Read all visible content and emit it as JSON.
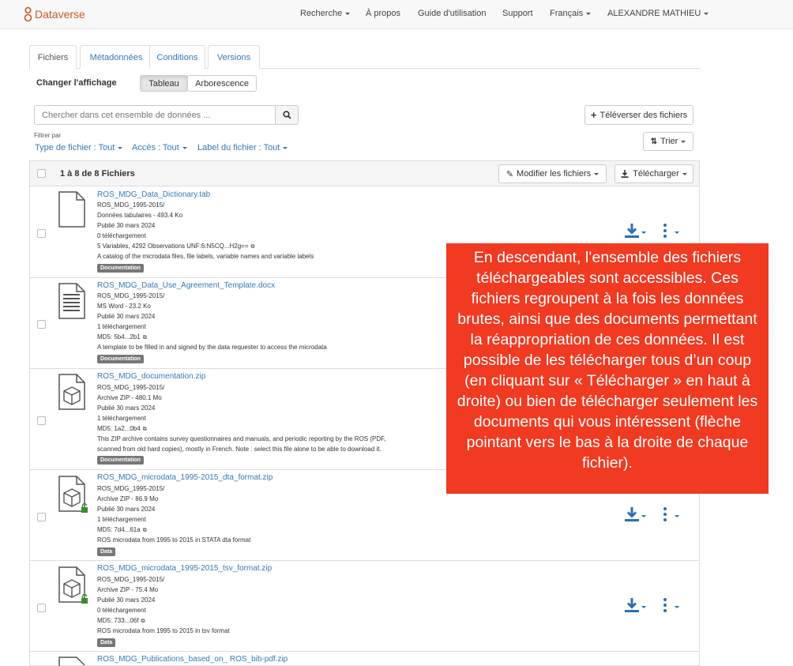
{
  "navbar": {
    "brand": "Dataverse",
    "items": [
      "Recherche",
      "À propos",
      "Guide d'utilisation",
      "Support",
      "Français",
      "ALEXANDRE MATHIEU"
    ]
  },
  "tabs": [
    "Fichiers",
    "Métadonnées",
    "Conditions",
    "Versions"
  ],
  "view": {
    "label": "Changer l'affichage",
    "options": [
      "Tableau",
      "Arborescence"
    ],
    "selected": "Tableau"
  },
  "search": {
    "placeholder": "Chercher dans cet ensemble de données ..."
  },
  "upload_button": "Téléverser des fichiers",
  "sort_button": "Trier",
  "filters": {
    "label": "Filtrer par",
    "items": [
      "Type de fichier : Tout",
      "Accès : Tout",
      "Label du fichier : Tout"
    ]
  },
  "table": {
    "count_label": "1 à 8 de 8 Fichiers",
    "edit_button": "Modifier les fichiers",
    "download_button": "Télécharger"
  },
  "files": [
    {
      "name": "ROS_MDG_Data_Dictionary.tab",
      "lines": [
        "ROS_MDG_1995-2015/",
        "Données tabulaires - 493.4 Ko",
        "Publié 30 mars 2024",
        "0 téléchargement",
        "5 Variables, 4292 Observations UNF:6:N5CQ...H2g==",
        "A catalog of the microdata files, file labels, variable names and variable labels"
      ],
      "tag": "Documentation"
    },
    {
      "name": "ROS_MDG_Data_Use_Agreement_Template.docx",
      "lines": [
        "ROS_MDG_1995-2015/",
        "MS Word - 23.2 Ko",
        "Publié 30 mars 2024",
        "1 téléchargement",
        "MD5: 5b4...2b1",
        "A template to be filled in and signed by the data requester to access the microdata"
      ],
      "tag": "Documentation"
    },
    {
      "name": "ROS_MDG_documentation.zip",
      "lines": [
        "ROS_MDG_1995-2015/",
        "Archive ZIP - 480.1 Mo",
        "Publié 30 mars 2024",
        "1 téléchargement",
        "MD5: 1a2...0b4",
        "This ZIP archive contains survey questionnaires and manuals, and periodic reporting by the ROS (PDF,",
        "scanned from old hard copies), mostly in French. Note : select this file alone to be able to download it."
      ],
      "tag": "Documentation"
    },
    {
      "name": "ROS_MDG_microdata_1995-2015_dta_format.zip",
      "lines": [
        "ROS_MDG_1995-2015/",
        "Archive ZIP - 86.9 Mo",
        "Publié 30 mars 2024",
        "1 téléchargement",
        "MD5: 7d4...61a",
        "ROS microdata from 1995 to 2015 in STATA dta format"
      ],
      "tag": "Data"
    },
    {
      "name": "ROS_MDG_microdata_1995-2015_tsv_format.zip",
      "lines": [
        "ROS_MDG_1995-2015/",
        "Archive ZIP - 75.4 Mo",
        "Publié 30 mars 2024",
        "0 téléchargement",
        "MD5: 733...06f",
        "ROS microdata from 1995 to 2015 in tsv format"
      ],
      "tag": "Data"
    },
    {
      "name": "ROS_MDG_Publications_based_on_ ROS_bib-pdf.zip",
      "lines": [],
      "tag": ""
    }
  ],
  "callout": "En descendant, l’ensemble des fichiers téléchargeables sont accessibles. Ces fichiers regroupent à la fois les données brutes, ainsi que des documents permettant la réappropriation de ces données. Il est possible de les télécharger tous d’un coup (en cliquant sur « Télécharger » en haut à droite) ou bien de télécharger seulement les documents qui vous intéressent (flèche pointant vers le bas à la droite de chaque fichier).",
  "colors": {
    "brand": "#c55b28",
    "link": "#337ab7",
    "callout": "#f03a21",
    "action": "#2c6fb0"
  },
  "icons": [
    "search-icon",
    "plus-icon",
    "sort-icon",
    "pencil-icon",
    "download-icon",
    "kebab-icon",
    "copy-icon",
    "lock-icon"
  ]
}
